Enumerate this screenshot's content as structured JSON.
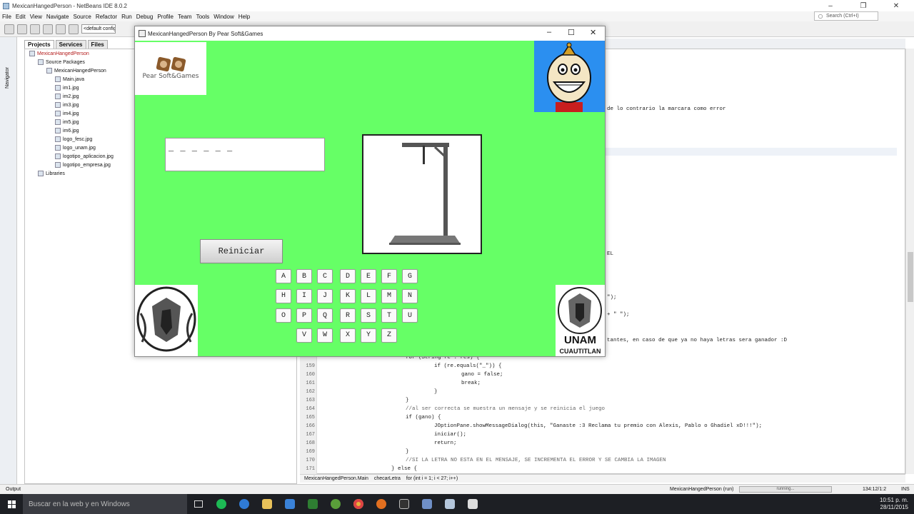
{
  "ide": {
    "title": "MexicanHangedPerson - NetBeans IDE 8.0.2",
    "menu": [
      "File",
      "Edit",
      "View",
      "Navigate",
      "Source",
      "Refactor",
      "Run",
      "Debug",
      "Profile",
      "Team",
      "Tools",
      "Window",
      "Help"
    ],
    "search_placeholder": "Search (Ctrl+I)",
    "config": "<default config>",
    "navigator_label": "Navigator",
    "tabs": [
      "Projects",
      "Services",
      "Files"
    ],
    "tree": [
      {
        "label": "MexicanHangedPerson",
        "red": true
      },
      {
        "label": "Source Packages"
      },
      {
        "label": "MexicanHangedPerson"
      },
      {
        "label": "Main.java"
      },
      {
        "label": "im1.jpg"
      },
      {
        "label": "im2.jpg"
      },
      {
        "label": "im3.jpg"
      },
      {
        "label": "im4.jpg"
      },
      {
        "label": "im5.jpg"
      },
      {
        "label": "im6.jpg"
      },
      {
        "label": "logo_fesc.jpg"
      },
      {
        "label": "logo_unam.jpg"
      },
      {
        "label": "logotipo_aplicacion.jpg"
      },
      {
        "label": "logotipo_empresa.jpg"
      },
      {
        "label": "Libraries"
      }
    ],
    "code_partial": [
      "de lo contrario la marcara como error",
      "EL",
      "\");",
      "+ \" \");",
      "tantes, en caso de que ya no haya letras sera ganador :D"
    ],
    "line_numbers": [
      "159",
      "160",
      "161",
      "162",
      "163",
      "164",
      "165",
      "166",
      "167",
      "168",
      "169",
      "170",
      "171"
    ],
    "code_lines": [
      "for (String re : res) {",
      "    if (re.equals(\"_\")) {",
      "        gano = false;",
      "        break;",
      "    }",
      "}",
      "//al ser correcta se muestra un mensaje y se reinicia el juego",
      "if (gano) {",
      "    JOptionPane.showMessageDialog(this, \"Ganaste :3 Reclama tu premio con Alexis, Pablo o Ghadiel xD!!!\");",
      "    iniciar();",
      "    return;",
      "}",
      "//SI LA LETRA NO ESTA EN EL MENSAJE, SE INCREMENTA EL ERROR Y SE CAMBIA LA IMAGEN",
      "} else {"
    ],
    "breadcrumbs": [
      "MexicanHangedPerson.Main",
      "checarLetra",
      "for (int i = 1; i < 27; i++)"
    ],
    "output_label": "Output",
    "status_project": "MexicanHangedPerson (run)",
    "status_running": "running...",
    "status_pos": "134:12/1:2",
    "status_ins": "INS"
  },
  "taskbar": {
    "search": "Buscar en la web y en Windows",
    "time": "10:51 p. m.",
    "date": "28/11/2015"
  },
  "game": {
    "window_title": "MexicanHangedPerson By Pear Soft&Games",
    "logo_text": "Pear Soft&Games",
    "word_display": "_ _ _ _ _ _",
    "restart_label": "Reiniciar",
    "unam_text": "UNAM",
    "cuautitlan_text": "CUAUTITLAN",
    "keys": [
      [
        "A",
        "B",
        "C",
        "D",
        "E",
        "F",
        "G"
      ],
      [
        "H",
        "I",
        "J",
        "K",
        "L",
        "M",
        "N"
      ],
      [
        "O",
        "P",
        "Q",
        "R",
        "S",
        "T",
        "U"
      ],
      [
        "V",
        "W",
        "X",
        "Y",
        "Z"
      ]
    ],
    "colors": {
      "background": "#66ff66",
      "avatar_bg": "#2b8ff0"
    }
  }
}
